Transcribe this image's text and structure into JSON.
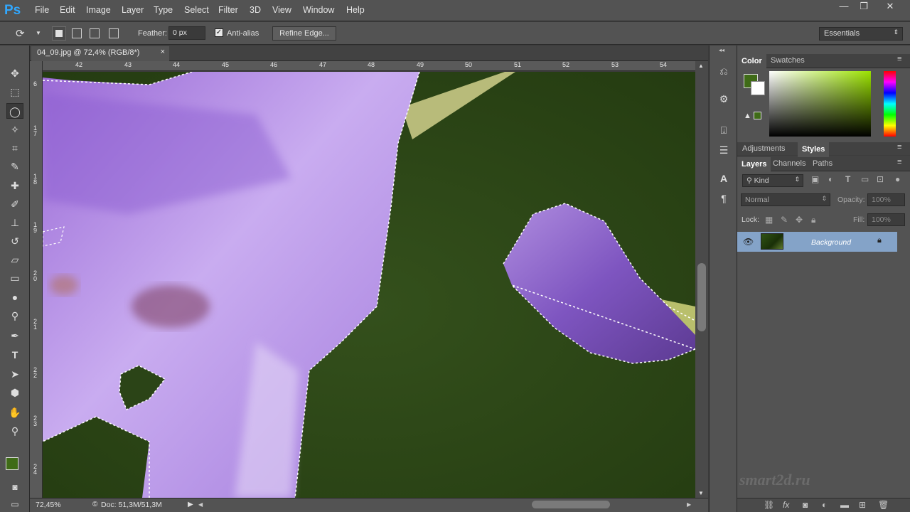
{
  "app": {
    "logo": "Ps"
  },
  "menu": [
    "File",
    "Edit",
    "Image",
    "Layer",
    "Type",
    "Select",
    "Filter",
    "3D",
    "View",
    "Window",
    "Help"
  ],
  "window_controls": {
    "minimize": "—",
    "restore": "❐",
    "close": "✕"
  },
  "options": {
    "feather_label": "Feather:",
    "feather_value": "0 px",
    "antialias_label": "Anti-alias",
    "antialias_checked": "✓",
    "refine_edge": "Refine Edge...",
    "workspace": "Essentials"
  },
  "document": {
    "tab_title": "04_09.jpg @ 72,4% (RGB/8*)",
    "tab_close": "×",
    "ruler_top": [
      "42",
      "43",
      "44",
      "45",
      "46",
      "47",
      "48",
      "49",
      "50",
      "51",
      "52",
      "53",
      "54"
    ],
    "ruler_left": [
      "6",
      "1\n7",
      "1\n8",
      "1\n9",
      "2\n0",
      "2\n1",
      "2\n2",
      "2\n3",
      "2\n4"
    ]
  },
  "status": {
    "zoom": "72,45%",
    "doc": "Doc: 51,3M/51,3M"
  },
  "panels": {
    "color_tabs": [
      "Color",
      "Swatches"
    ],
    "adj_tabs": [
      "Adjustments",
      "Styles"
    ],
    "layer_tabs": [
      "Layers",
      "Channels",
      "Paths"
    ],
    "kind": "Kind",
    "blend_mode": "Normal",
    "opacity_label": "Opacity:",
    "opacity_value": "100%",
    "lock_label": "Lock:",
    "fill_label": "Fill:",
    "fill_value": "100%",
    "layer_name": "Background"
  },
  "colors": {
    "foreground": "#3f6b17",
    "background": "#ffffff",
    "accent": "#31a8ff"
  },
  "watermark": "smart2d.ru"
}
